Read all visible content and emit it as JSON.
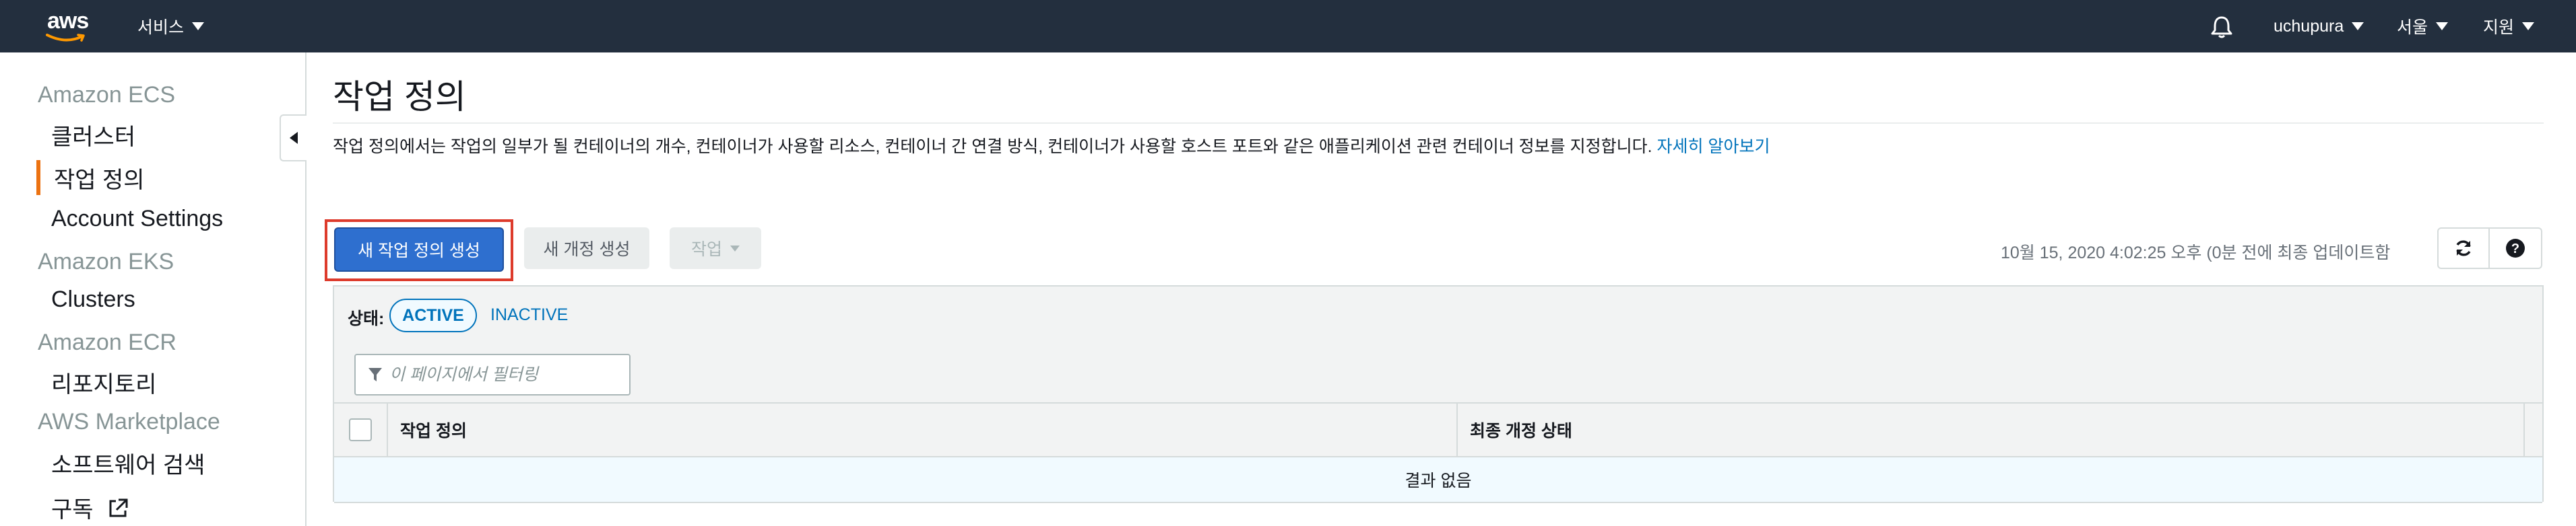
{
  "topnav": {
    "logo_text": "aws",
    "services_label": "서비스",
    "user_label": "uchupura",
    "region_label": "서울",
    "support_label": "지원"
  },
  "sidebar": {
    "ecs_section": "Amazon ECS",
    "clusters_label": "클러스터",
    "task_definitions_label": "작업 정의",
    "account_settings_label": "Account Settings",
    "eks_section": "Amazon EKS",
    "eks_clusters_label": "Clusters",
    "ecr_section": "Amazon ECR",
    "repositories_label": "리포지토리",
    "marketplace_section": "AWS Marketplace",
    "software_search_label": "소프트웨어 검색",
    "subscriptions_label": "구독"
  },
  "main": {
    "title": "작업 정의",
    "description": "작업 정의에서는 작업의 일부가 될 컨테이너의 개수, 컨테이너가 사용할 리소스, 컨테이너 간 연결 방식, 컨테이너가 사용할 호스트 포트와 같은 애플리케이션 관련 컨테이너 정보를 지정합니다.",
    "learn_more_label": "자세히 알아보기",
    "create_button_label": "새 작업 정의 생성",
    "create_revision_label": "새 개정 생성",
    "actions_label": "작업",
    "timestamp": "10월 15, 2020 4:02:25 오후 (0분 전에 최종 업데이트함"
  },
  "table": {
    "status_label": "상태:",
    "status_active": "ACTIVE",
    "status_inactive": "INACTIVE",
    "filter_placeholder": "이 페이지에서 필터링",
    "col_task_definition": "작업 정의",
    "col_latest_revision_status": "최종 개정 상태",
    "empty_message": "결과 없음"
  },
  "colors": {
    "nav_bg": "#232f3e",
    "primary": "#2e6fcf",
    "link": "#0073bb",
    "active_accent": "#ec7211",
    "highlight_outline": "#dd3b2c"
  },
  "icons": [
    "aws-logo",
    "caret-down-icon",
    "bell-icon",
    "collapse-left-icon",
    "external-link-icon",
    "refresh-icon",
    "help-icon",
    "filter-icon"
  ]
}
